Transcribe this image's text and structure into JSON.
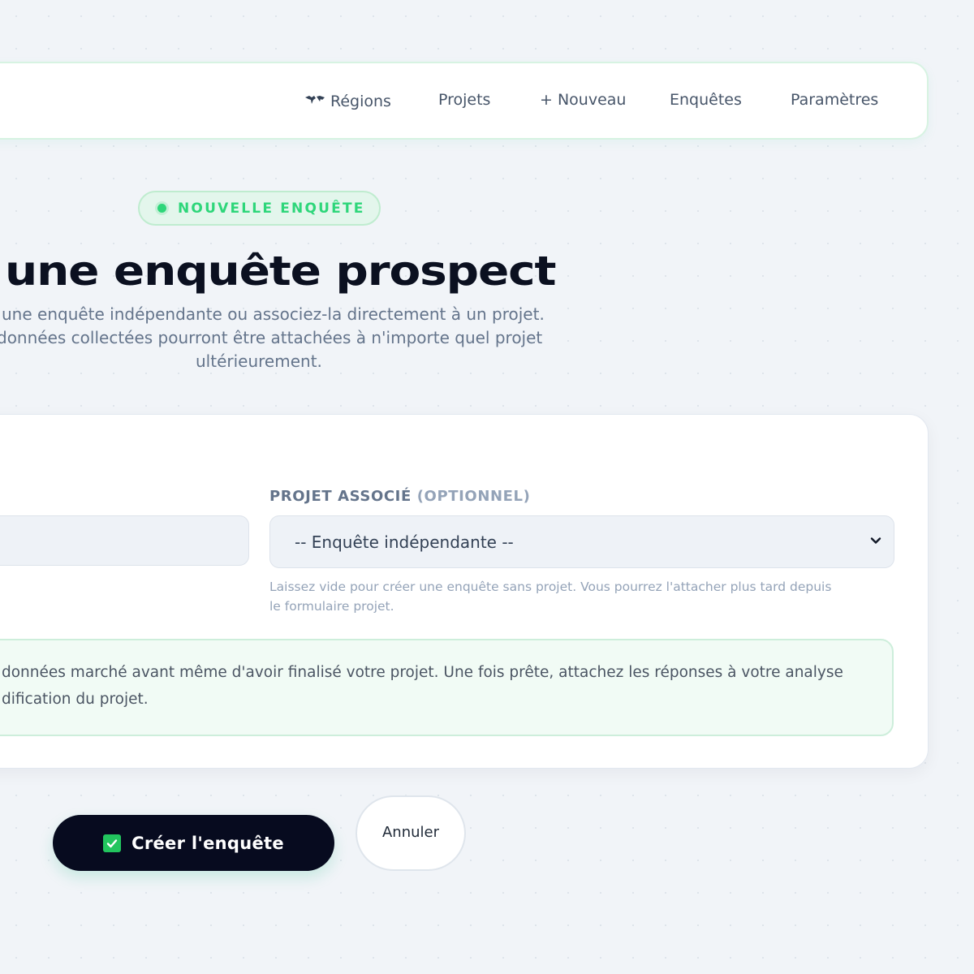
{
  "nav": {
    "items": [
      {
        "label": "Régions",
        "icon": "world-map-icon"
      },
      {
        "label": "Projets"
      },
      {
        "label": "+ Nouveau"
      },
      {
        "label": "Enquêtes"
      },
      {
        "label": "Paramètres"
      }
    ]
  },
  "badge": {
    "label": "NOUVELLE ENQUÊTE",
    "color": "#2ed67a"
  },
  "heading": {
    "title": "une enquête prospect",
    "subtitle_lines": [
      "une enquête indépendante ou associez-la directement à un projet.",
      "données collectées pourront être attachées à n'importe quel projet",
      "ultérieurement."
    ]
  },
  "form": {
    "project_label": "PROJET ASSOCIÉ",
    "project_label_optional": "(OPTIONNEL)",
    "project_select_value": "-- Enquête indépendante --",
    "project_help_lines": [
      "Laissez vide pour créer une enquête sans projet. Vous pourrez l'attacher plus tard depuis",
      "le formulaire projet."
    ],
    "info_lines": [
      "données marché avant même d'avoir finalisé votre projet. Une fois prête, attachez les réponses à votre analyse",
      "dification du projet."
    ]
  },
  "actions": {
    "create_label": "Créer l'enquête",
    "create_icon": "check-box-icon",
    "cancel_label": "Annuler"
  },
  "colors": {
    "accent": "#2ed67a",
    "primary_button": "#070b1f"
  }
}
